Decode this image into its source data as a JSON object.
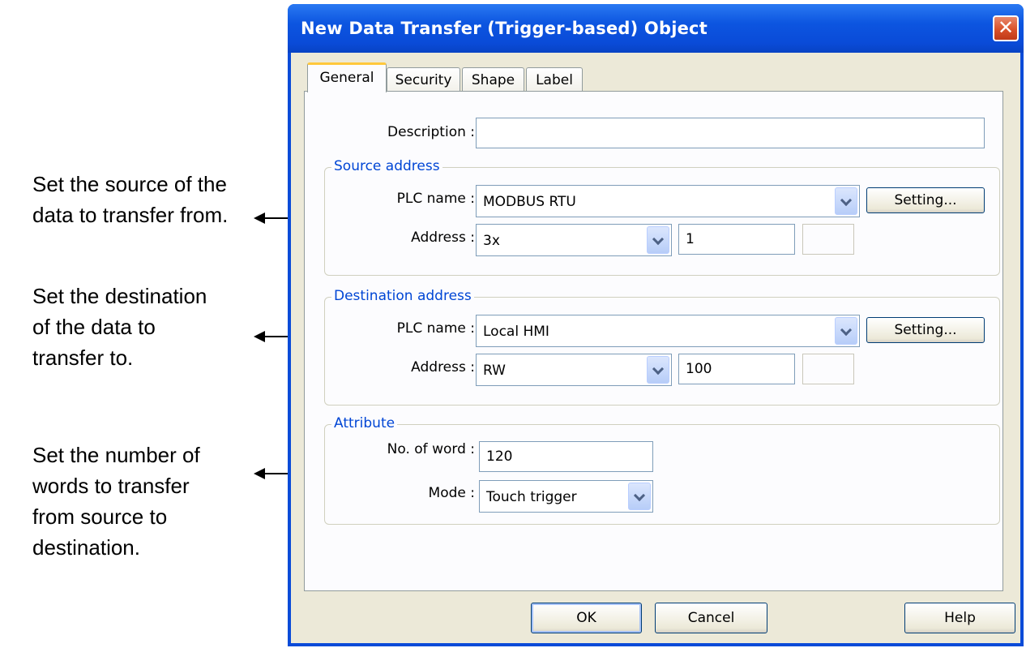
{
  "annotations": {
    "source": [
      "Set the source of the",
      "data to transfer from."
    ],
    "destination": [
      "Set the destination",
      "of the data to",
      "transfer to."
    ],
    "attribute": [
      "Set the number of",
      "words to transfer",
      "from source to",
      "destination."
    ]
  },
  "dialog": {
    "title": "New  Data Transfer (Trigger-based) Object",
    "close_glyph": "✕",
    "tabs": [
      {
        "label": "General",
        "active": true
      },
      {
        "label": "Security",
        "active": false
      },
      {
        "label": "Shape",
        "active": false
      },
      {
        "label": "Label",
        "active": false
      }
    ],
    "description": {
      "label": "Description :",
      "value": ""
    },
    "source": {
      "title": "Source address",
      "plc_label": "PLC name :",
      "plc_value": "MODBUS RTU",
      "setting_label": "Setting...",
      "address_label": "Address :",
      "address_type": "3x",
      "address_value": "1"
    },
    "destination": {
      "title": "Destination address",
      "plc_label": "PLC name :",
      "plc_value": "Local HMI",
      "setting_label": "Setting...",
      "address_label": "Address :",
      "address_type": "RW",
      "address_value": "100"
    },
    "attribute": {
      "title": "Attribute",
      "words_label": "No. of word :",
      "words_value": "120",
      "mode_label": "Mode :",
      "mode_value": "Touch trigger"
    },
    "buttons": {
      "ok": "OK",
      "cancel": "Cancel",
      "help": "Help"
    }
  },
  "colors": {
    "title_bar": "#0a4bd8",
    "group_title": "#0046d5",
    "dialog_face": "#ece9d8",
    "close_button": "#d9512a"
  }
}
